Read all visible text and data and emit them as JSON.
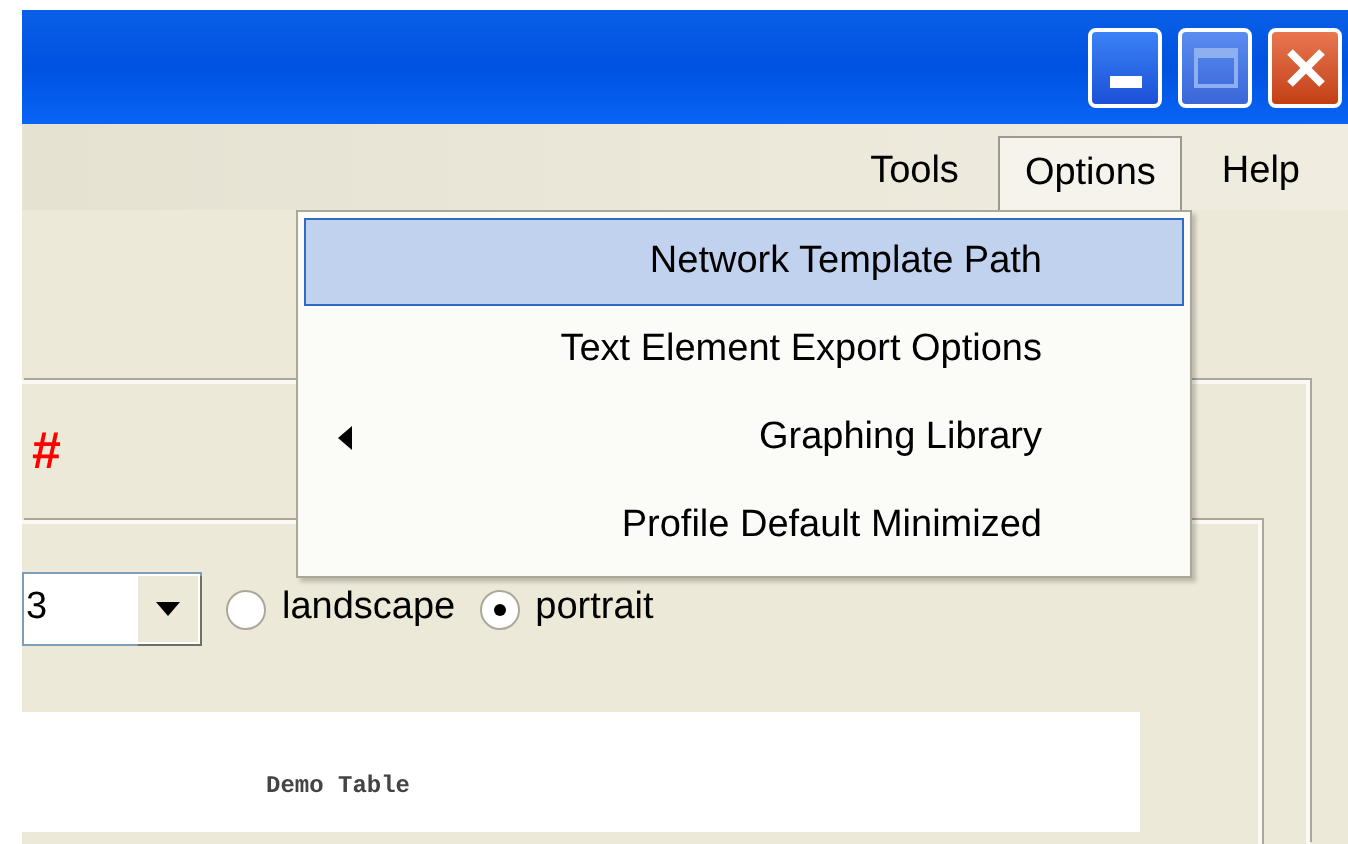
{
  "menu_bar": [
    {
      "label": "Tools",
      "selected": false
    },
    {
      "label": "Options",
      "selected": true
    },
    {
      "label": "Help",
      "selected": false
    }
  ],
  "options_menu": [
    {
      "label": "Network Template Path",
      "selected": true,
      "submenu": false
    },
    {
      "label": "Text Element Export Options",
      "selected": false,
      "submenu": false
    },
    {
      "label": "Graphing Library",
      "selected": false,
      "submenu": true
    },
    {
      "label": "Profile Default Minimized",
      "selected": false,
      "submenu": false
    }
  ],
  "marker": "#",
  "size_combo": {
    "value": "3"
  },
  "orientation": [
    {
      "label": "landscape",
      "selected": false
    },
    {
      "label": "portrait",
      "selected": true
    }
  ],
  "preview": {
    "title": "Demo Table"
  }
}
